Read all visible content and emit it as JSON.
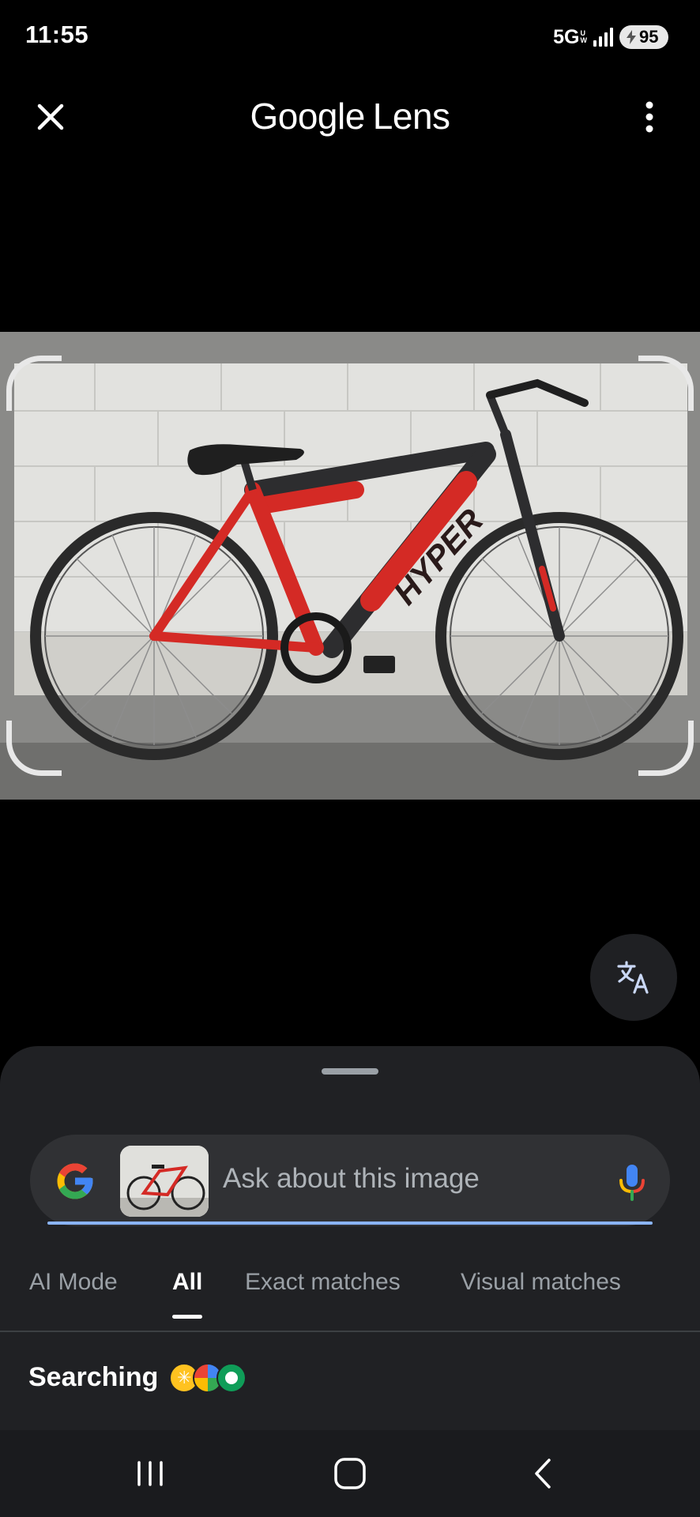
{
  "status_bar": {
    "time": "11:55",
    "network": "5G",
    "network_sub_top": "U",
    "network_sub_bottom": "W",
    "battery": "95"
  },
  "app_bar": {
    "brand_google": "Google",
    "brand_lens": "Lens",
    "close_icon": "close-icon",
    "more_icon": "more-vert-icon"
  },
  "image_panel": {
    "subject": "red and black hybrid bicycle",
    "frame_text": "HYPER"
  },
  "translate_button": {
    "icon": "translate-icon"
  },
  "search": {
    "placeholder": "Ask about this image",
    "logo_icon": "google-g-icon",
    "mic_icon": "mic-icon"
  },
  "tabs": [
    {
      "label": "AI Mode",
      "active": false
    },
    {
      "label": "All",
      "active": true
    },
    {
      "label": "Exact matches",
      "active": false
    },
    {
      "label": "Visual matches",
      "active": false
    }
  ],
  "results": {
    "status_text": "Searching",
    "source_icons": [
      "walmart-icon",
      "marketplace-icon",
      "green-source-icon"
    ]
  },
  "nav_bar": {
    "recents_icon": "recents-icon",
    "home_icon": "home-icon",
    "back_icon": "back-icon"
  },
  "colors": {
    "accent_blue": "#8ab4f8",
    "sheet_bg": "#202124",
    "search_bg": "#303134",
    "bike_red": "#d42a25"
  }
}
